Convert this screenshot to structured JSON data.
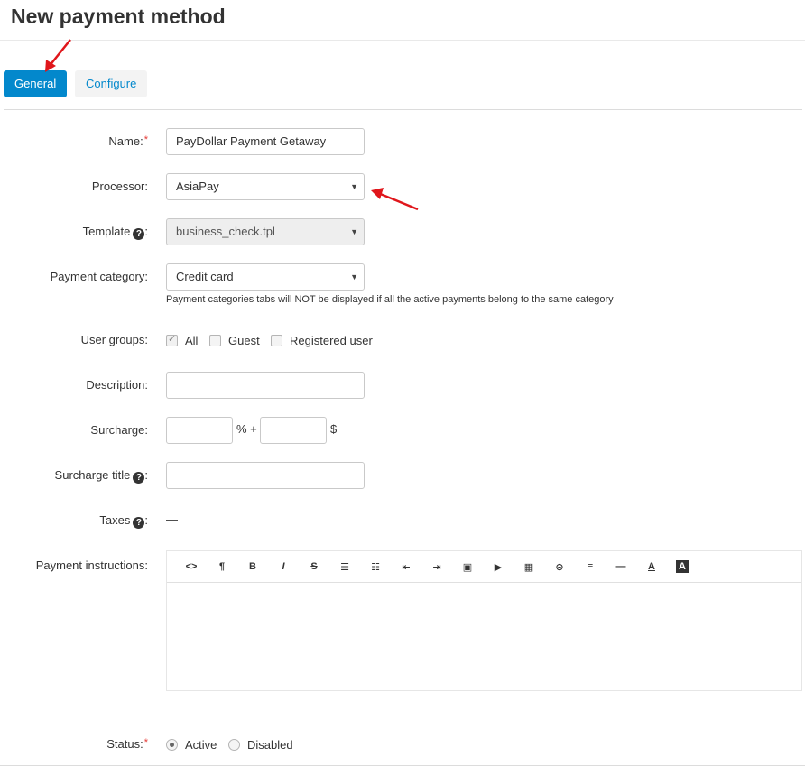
{
  "header": {
    "title": "New payment method"
  },
  "tabs": [
    {
      "label": "General",
      "active": true
    },
    {
      "label": "Configure",
      "active": false
    }
  ],
  "form": {
    "name": {
      "label": "Name:",
      "required_mark": "*",
      "value": "PayDollar Payment Getaway"
    },
    "processor": {
      "label": "Processor:",
      "value": "AsiaPay"
    },
    "template": {
      "label": "Template",
      "suffix": ":",
      "value": "business_check.tpl"
    },
    "payment_category": {
      "label": "Payment category:",
      "value": "Credit card",
      "hint": "Payment categories tabs will NOT be displayed if all the active payments belong to the same category"
    },
    "user_groups": {
      "label": "User groups:",
      "options": [
        {
          "label": "All",
          "checked": true
        },
        {
          "label": "Guest",
          "checked": false
        },
        {
          "label": "Registered user",
          "checked": false
        }
      ]
    },
    "description": {
      "label": "Description:",
      "value": ""
    },
    "surcharge": {
      "label": "Surcharge:",
      "percent_value": "",
      "percent_sep": "% +",
      "fixed_value": "",
      "currency": "$"
    },
    "surcharge_title": {
      "label": "Surcharge title",
      "suffix": ":",
      "value": ""
    },
    "taxes": {
      "label": "Taxes",
      "suffix": ":",
      "value": "—"
    },
    "payment_instructions": {
      "label": "Payment instructions:",
      "toolbar": [
        {
          "icon": "code-view-icon",
          "glyph": "<>"
        },
        {
          "icon": "paragraph-icon",
          "glyph": "¶"
        },
        {
          "icon": "bold-icon",
          "glyph": "B"
        },
        {
          "icon": "italic-icon",
          "glyph": "I"
        },
        {
          "icon": "strikethrough-icon",
          "glyph": "S"
        },
        {
          "icon": "unordered-list-icon",
          "glyph": "☰"
        },
        {
          "icon": "ordered-list-icon",
          "glyph": "☷"
        },
        {
          "icon": "outdent-icon",
          "glyph": "⇤"
        },
        {
          "icon": "indent-icon",
          "glyph": "⇥"
        },
        {
          "icon": "image-icon",
          "glyph": "▣"
        },
        {
          "icon": "video-icon",
          "glyph": "▶"
        },
        {
          "icon": "table-icon",
          "glyph": "▦"
        },
        {
          "icon": "link-icon",
          "glyph": "⊝"
        },
        {
          "icon": "align-icon",
          "glyph": "≡"
        },
        {
          "icon": "horizontal-rule-icon",
          "glyph": "—"
        },
        {
          "icon": "font-color-icon",
          "glyph": "A"
        },
        {
          "icon": "back-color-icon",
          "glyph": "A"
        }
      ]
    },
    "status": {
      "label": "Status:",
      "required_mark": "*",
      "options": [
        {
          "label": "Active",
          "selected": true
        },
        {
          "label": "Disabled",
          "selected": false
        }
      ]
    }
  },
  "colors": {
    "accent": "#0388cc",
    "annotation_arrow": "#e0161b",
    "required": "#e53935"
  }
}
